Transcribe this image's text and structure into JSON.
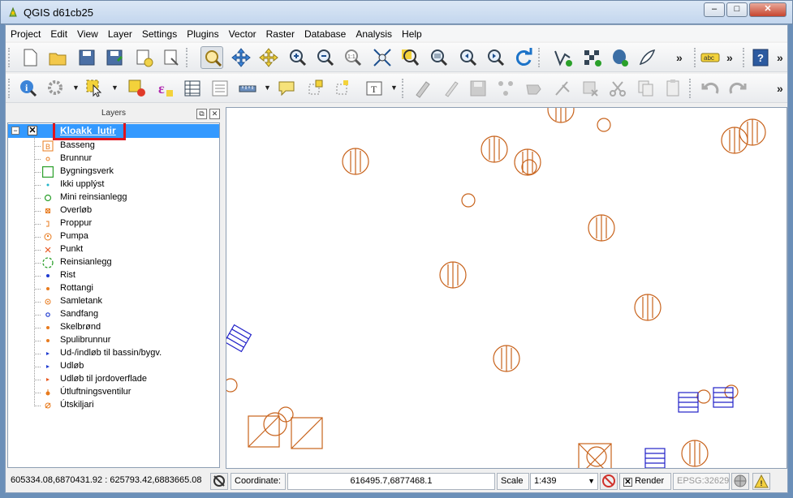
{
  "window": {
    "title": "QGIS d61cb25"
  },
  "menu": [
    "Project",
    "Edit",
    "View",
    "Layer",
    "Settings",
    "Plugins",
    "Vector",
    "Raster",
    "Database",
    "Analysis",
    "Help"
  ],
  "layers_panel": {
    "title": "Layers",
    "layer": {
      "name": "Kloakk_lutir",
      "visible": true,
      "expanded": true
    },
    "legend": [
      {
        "label": "Basseng",
        "icon": "square-b-icon",
        "color": "#e87b1e"
      },
      {
        "label": "Brunnur",
        "icon": "small-circle-icon",
        "color": "#e87b1e"
      },
      {
        "label": "Bygningsverk",
        "icon": "green-square-icon",
        "color": "#2ca02c"
      },
      {
        "label": "Ikki upplýst",
        "icon": "cyan-dot-icon",
        "color": "#21b5c9"
      },
      {
        "label": "Mini reinsianlegg",
        "icon": "green-circle-icon",
        "color": "#2ca02c"
      },
      {
        "label": "Overløb",
        "icon": "orange-square-x-icon",
        "color": "#e87b1e"
      },
      {
        "label": "Proppur",
        "icon": "proppur-icon",
        "color": "#e87b1e"
      },
      {
        "label": "Pumpa",
        "icon": "pump-circle-icon",
        "color": "#e87b1e"
      },
      {
        "label": "Punkt",
        "icon": "x-cross-icon",
        "color": "#e8571e"
      },
      {
        "label": "Reinsianlegg",
        "icon": "dashed-green-circle-icon",
        "color": "#2ca02c"
      },
      {
        "label": "Rist",
        "icon": "blue-dot-icon",
        "color": "#1f3bd0"
      },
      {
        "label": "Rottangi",
        "icon": "orange-dot-icon",
        "color": "#e87b1e"
      },
      {
        "label": "Samletank",
        "icon": "target-icon",
        "color": "#e87b1e"
      },
      {
        "label": "Sandfang",
        "icon": "blue-ring-icon",
        "color": "#1f3bd0"
      },
      {
        "label": "Skelbrønd",
        "icon": "orange-dot-icon",
        "color": "#e87b1e"
      },
      {
        "label": "Spulibrunnur",
        "icon": "orange-dot-icon",
        "color": "#e87b1e"
      },
      {
        "label": "Ud-/indløb til bassin/bygv.",
        "icon": "blue-arrow-icon",
        "color": "#1f3bd0"
      },
      {
        "label": "Udløb",
        "icon": "blue-arrow-icon",
        "color": "#1f3bd0"
      },
      {
        "label": "Udløb til jordoverflade",
        "icon": "orange-arrow-icon",
        "color": "#e8571e"
      },
      {
        "label": "Útluftningsventilur",
        "icon": "orange-drop-icon",
        "color": "#e87b1e"
      },
      {
        "label": "Útskiljari",
        "icon": "orange-slashed-circle-icon",
        "color": "#e87b1e"
      }
    ]
  },
  "statusbar": {
    "extent": "605334.08,6870431.92 : 625793.42,6883665.08",
    "coordinate_label": "Coordinate:",
    "coordinate": "616495.7,6877468.1",
    "scale_label": "Scale",
    "scale": "1:439",
    "render_label": "Render",
    "crs": "EPSG:32629"
  },
  "colors": {
    "feature_orange": "#c8631c",
    "feature_blue": "#2222c8",
    "selection_blue": "#3399ff",
    "highlight_red": "#e0141d"
  }
}
